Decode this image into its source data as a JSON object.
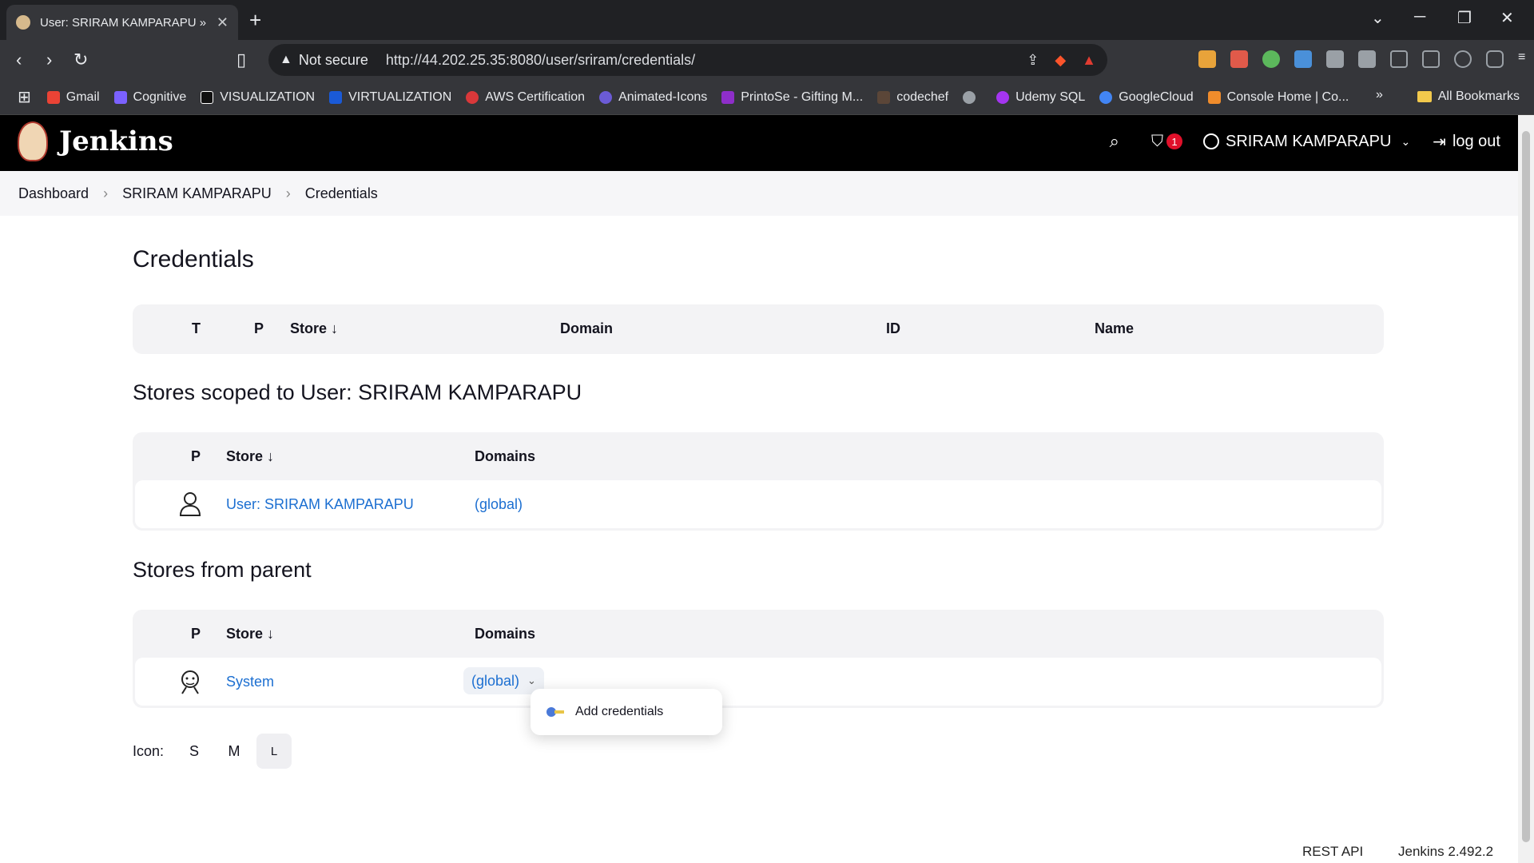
{
  "browser": {
    "tab_title": "User: SRIRAM KAMPARAPU » C",
    "security_label": "Not secure",
    "url": "http://44.202.25.35:8080/user/sriram/credentials/",
    "bookmarks": [
      "Gmail",
      "Cognitive",
      "VISUALIZATION",
      "VIRTUALIZATION",
      "AWS Certification",
      "Animated-Icons",
      "PrintoSe - Gifting M...",
      "codechef",
      "",
      "Udemy SQL",
      "GoogleCloud",
      "Console Home | Co..."
    ],
    "all_bookmarks": "All Bookmarks",
    "more_bookmarks": "»"
  },
  "header": {
    "app_name": "Jenkins",
    "alert_count": "1",
    "user_name": "SRIRAM KAMPARAPU",
    "logout": "log out"
  },
  "breadcrumb": [
    "Dashboard",
    "SRIRAM KAMPARAPU",
    "Credentials"
  ],
  "page_title": "Credentials",
  "credentials_table": {
    "headers": [
      "T",
      "P",
      "Store ↓",
      "Domain",
      "ID",
      "Name"
    ]
  },
  "user_stores": {
    "title": "Stores scoped to User: SRIRAM KAMPARAPU",
    "headers": [
      "P",
      "Store ↓",
      "Domains"
    ],
    "row": {
      "store": "User: SRIRAM KAMPARAPU",
      "domain": "(global)"
    }
  },
  "parent_stores": {
    "title": "Stores from parent",
    "headers": [
      "P",
      "Store ↓",
      "Domains"
    ],
    "row": {
      "store": "System",
      "domain": "(global)"
    }
  },
  "dropdown_menu": {
    "item": "Add credentials"
  },
  "icon_size": {
    "label": "Icon:",
    "options": [
      "S",
      "M",
      "L"
    ],
    "selected": "L"
  },
  "footer": {
    "rest_api": "REST API",
    "version": "Jenkins 2.492.2"
  },
  "colors": {
    "link": "#1c6fd1",
    "badge": "#e0102a",
    "header_bg": "#000000"
  }
}
